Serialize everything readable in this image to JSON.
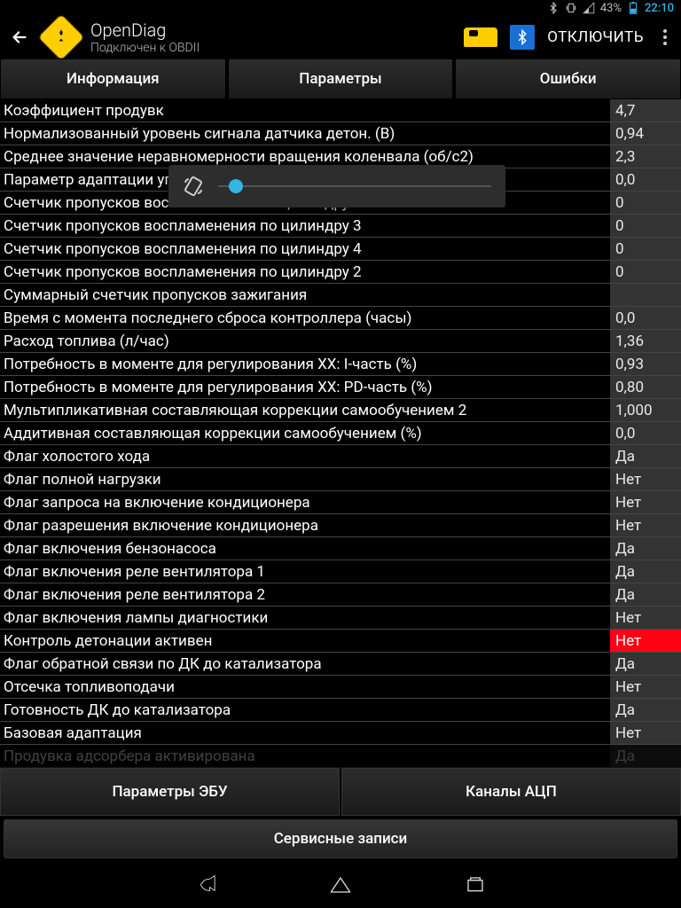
{
  "status": {
    "battery": "43%",
    "time": "22:10"
  },
  "header": {
    "title": "OpenDiag",
    "subtitle": "Подключен к OBDII",
    "disconnect": "ОТКЛЮЧИТЬ"
  },
  "tabs": {
    "info": "Информация",
    "params": "Параметры",
    "errors": "Ошибки"
  },
  "params": [
    {
      "label": "Коэффициент продувк",
      "value": "4,7"
    },
    {
      "label": "Нормализованный уровень сигнала датчика детон. (В)",
      "value": "0,94"
    },
    {
      "label": "Среднее значение неравномерности вращения коленвала (об/с2)",
      "value": "2,3"
    },
    {
      "label": "Параметр адаптации угла погрешности зубьев венца демпф.",
      "value": "0,0"
    },
    {
      "label": "Счетчик пропусков воспламенения по цилиндру 1",
      "value": "0"
    },
    {
      "label": "Счетчик пропусков воспламенения по цилиндру 3",
      "value": "0"
    },
    {
      "label": "Счетчик пропусков воспламенения по цилиндру 4",
      "value": "0"
    },
    {
      "label": "Счетчик пропусков воспламенения по цилиндру 2",
      "value": "0"
    },
    {
      "label": "Суммарный счетчик пропусков зажигания",
      "value": ""
    },
    {
      "label": "Время с момента последнего сброса контроллера (часы)",
      "value": "0,0"
    },
    {
      "label": "Расход топлива (л/час)",
      "value": "1,36"
    },
    {
      "label": "Потребность в моменте для регулирования ХХ: I-часть (%)",
      "value": "0,93"
    },
    {
      "label": "Потребность в моменте для регулирования ХХ: PD-часть (%)",
      "value": "0,80"
    },
    {
      "label": "Мультипликативная составляющая коррекции самообучением 2",
      "value": "1,000"
    },
    {
      "label": "Аддитивная составляющая коррекции самообучением (%)",
      "value": "0,0"
    },
    {
      "label": "Флаг холостого хода",
      "value": "Да"
    },
    {
      "label": "Флаг полной нагрузки",
      "value": "Нет"
    },
    {
      "label": "Флаг запроса на включение кондиционера",
      "value": "Нет"
    },
    {
      "label": "Флаг разрешения включение кондиционера",
      "value": "Нет"
    },
    {
      "label": "Флаг включения бензонасоса",
      "value": "Да"
    },
    {
      "label": "Флаг включения реле вентилятора 1",
      "value": "Да"
    },
    {
      "label": "Флаг включения реле вентилятора 2",
      "value": "Да"
    },
    {
      "label": "Флаг включения лампы диагностики",
      "value": "Нет"
    },
    {
      "label": "Контроль детонации активен",
      "value": "Нет",
      "highlight": true
    },
    {
      "label": "Флаг обратной связи по ДК до катализатора",
      "value": "Да"
    },
    {
      "label": "Отсечка топливоподачи",
      "value": "Нет"
    },
    {
      "label": "Готовность ДК до катализатора",
      "value": "Да"
    },
    {
      "label": "Базовая адаптация",
      "value": "Нет"
    },
    {
      "label": "Продувка адсорбера активирована",
      "value": "Да",
      "fade": true
    }
  ],
  "bottom": {
    "ecu": "Параметры ЭБУ",
    "adc": "Каналы АЦП",
    "service": "Сервисные записи"
  }
}
